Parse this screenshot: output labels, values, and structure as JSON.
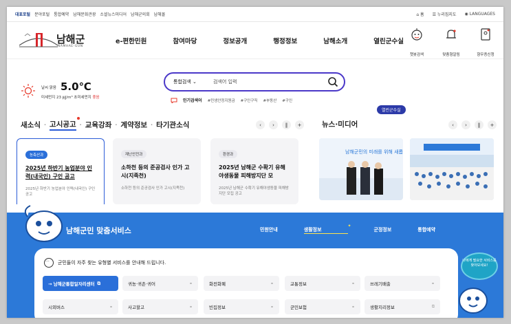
{
  "utility_bar": {
    "left_links": [
      "대표포털",
      "분야포털",
      "통합예약",
      "남해문화관광",
      "소셜뉴스미디어",
      "남해군의회",
      "남해몰"
    ],
    "right_links": [
      "홈",
      "누리집지도",
      "LANGUAGES"
    ]
  },
  "header": {
    "logo_text": "남해군",
    "logo_sub": "NAMHAE-GUN",
    "gnb": [
      "e-편한민원",
      "참여마당",
      "정보공개",
      "행정정보",
      "남해소개",
      "열린군수실"
    ],
    "quick": [
      {
        "label": "챗봇검색",
        "icon": "chatbot-icon"
      },
      {
        "label": "맞춤형알림",
        "icon": "bell-icon"
      },
      {
        "label": "향우증신청",
        "icon": "id-card-icon"
      }
    ]
  },
  "weather": {
    "label": "날씨 맑음",
    "temp": "5.0℃",
    "dust_text": "미세먼지 23 ㎍/m³  초미세먼지 ",
    "dust_status": "좋음"
  },
  "search": {
    "selector": "통합검색",
    "placeholder": "검색어 입력",
    "popular_label": "인기검색어",
    "popular_terms": [
      "#민생안정지원금",
      "#구인구직",
      "#부동산",
      "#구인"
    ]
  },
  "mayor_tag": "열린군수실",
  "news": {
    "tabs": [
      "새소식",
      "고시공고",
      "교육강좌",
      "계약정보",
      "타기관소식"
    ],
    "active_tab": "고시공고",
    "media_title": "뉴스·미디어",
    "cards": [
      {
        "badge": "농축산과",
        "title": "2025년 하반기 농업분야 인력(내국인) 구인 공고",
        "desc": "2025년 하반기 농업분야 인력(내국인) 구인 공고"
      },
      {
        "badge": "재난안전과",
        "title": "소하천 등의 준공검사 인가 고시(지족천)",
        "desc": "소하천 등의 준공검사 인가 고시(지족천)"
      },
      {
        "badge": "환경과",
        "title": "2025년 남해군 수확기 유해야생동물 피해방지단 모",
        "desc": "2025년 남해군 수확기 유해야생동물 피해방지단 모집 공고"
      }
    ],
    "photo_caption": "남해군민의 미래를 위해 새롭게 도약하다"
  },
  "service": {
    "title": "남해군민 맞춤서비스",
    "tabs": [
      "민원안내",
      "생활정보",
      "군정정보",
      "통합예약"
    ],
    "active_tab": "생활정보",
    "guide": "군민들이 자주 찾는 유형별 서비스를 안내해 드립니다.",
    "items_row1": [
      "→ 남해군통합일자리센터",
      "귀농·귀촌·귀어",
      "화전화폐",
      "교통정보",
      "쓰레기배출"
    ],
    "items_row2": [
      "시외버스",
      "사고할고",
      "빈집정보",
      "군민보험",
      "생활지리정보"
    ],
    "helper": "나에게 필요한 서비스를 찾아보세요!"
  },
  "colors": {
    "accent": "#2a5bd7",
    "search_border": "#4a37c8",
    "band": "#2c79d8",
    "highlight": "#ffe44d",
    "alert": "#e23b3b"
  }
}
